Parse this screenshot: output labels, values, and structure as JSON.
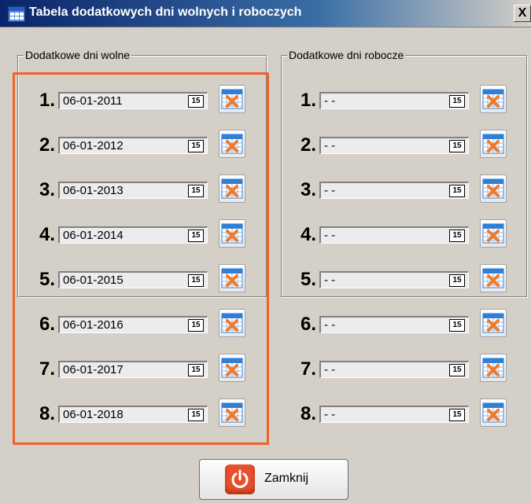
{
  "window": {
    "title": "Tabela dodatkowych dni wolnych i roboczych",
    "close_label": "X"
  },
  "groups": {
    "left": {
      "label": "Dodatkowe dni wolne",
      "rows": [
        {
          "num": "1.",
          "date": "06-01-2011"
        },
        {
          "num": "2.",
          "date": "06-01-2012"
        },
        {
          "num": "3.",
          "date": "06-01-2013"
        },
        {
          "num": "4.",
          "date": "06-01-2014"
        },
        {
          "num": "5.",
          "date": "06-01-2015"
        },
        {
          "num": "6.",
          "date": "06-01-2016"
        },
        {
          "num": "7.",
          "date": "06-01-2017"
        },
        {
          "num": "8.",
          "date": "06-01-2018"
        }
      ]
    },
    "right": {
      "label": "Dodatkowe dni robocze",
      "rows": [
        {
          "num": "1.",
          "date": "- -"
        },
        {
          "num": "2.",
          "date": "- -"
        },
        {
          "num": "3.",
          "date": "- -"
        },
        {
          "num": "4.",
          "date": "- -"
        },
        {
          "num": "5.",
          "date": "- -"
        },
        {
          "num": "6.",
          "date": "- -"
        },
        {
          "num": "7.",
          "date": "- -"
        },
        {
          "num": "8.",
          "date": "- -"
        }
      ]
    }
  },
  "calendar_button_label": "15",
  "footer": {
    "close_button_label": "Zamknij"
  },
  "colors": {
    "highlight": "#f2612a",
    "clear_icon_x": "#f07a2a",
    "clear_icon_header": "#2f7fd8",
    "power_icon": "#e8502d"
  },
  "icons": {
    "calendar": "calendar-icon",
    "clear": "calendar-clear-icon",
    "power": "power-icon"
  }
}
